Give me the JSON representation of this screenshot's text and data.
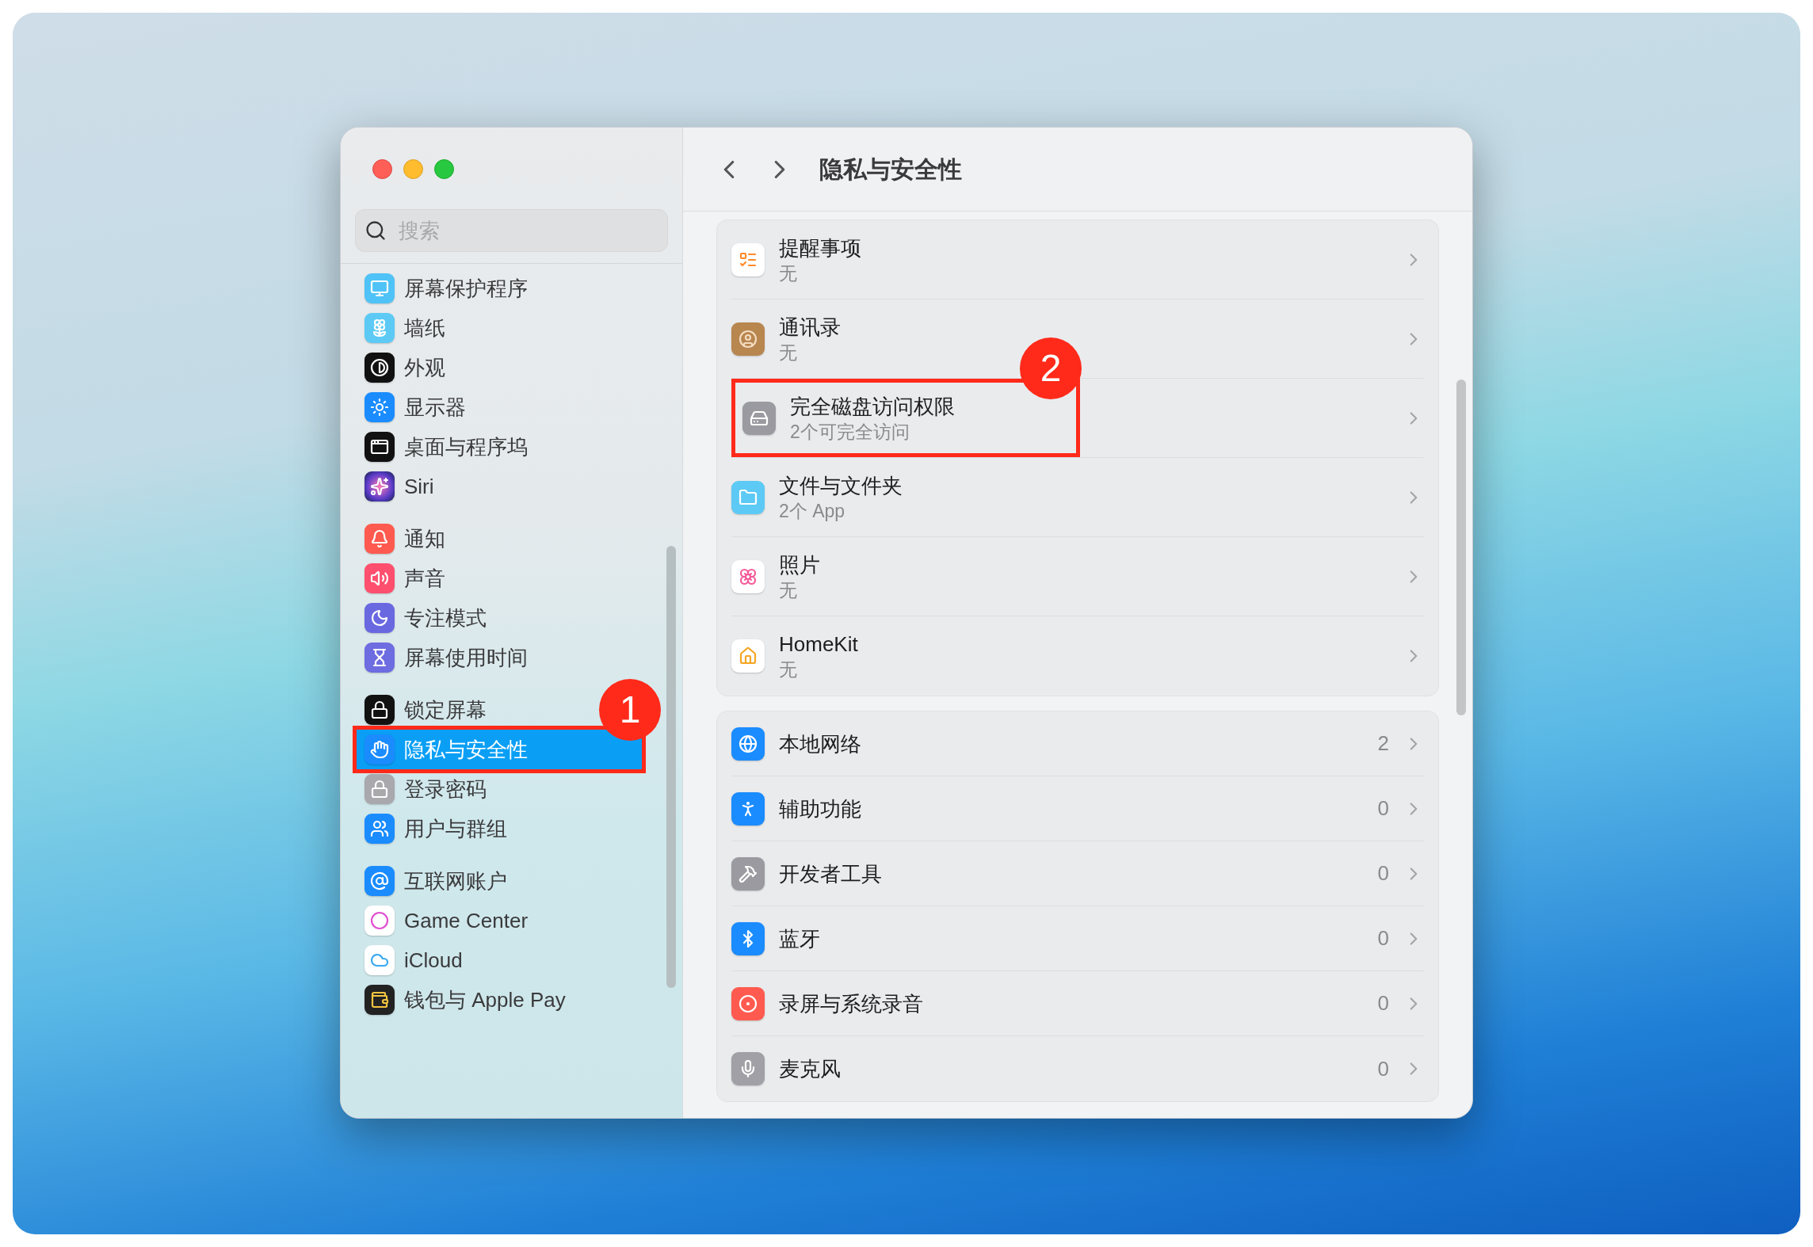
{
  "window": {
    "title": "隐私与安全性"
  },
  "sidebar": {
    "search": {
      "placeholder": "搜索"
    },
    "groups": [
      {
        "items": [
          {
            "label": "屏幕保护程序",
            "selected": false
          },
          {
            "label": "墙纸",
            "selected": false
          },
          {
            "label": "外观",
            "selected": false
          },
          {
            "label": "显示器",
            "selected": false
          },
          {
            "label": "桌面与程序坞",
            "selected": false
          },
          {
            "label": "Siri",
            "selected": false
          }
        ]
      },
      {
        "items": [
          {
            "label": "通知",
            "selected": false
          },
          {
            "label": "声音",
            "selected": false
          },
          {
            "label": "专注模式",
            "selected": false
          },
          {
            "label": "屏幕使用时间",
            "selected": false
          }
        ]
      },
      {
        "items": [
          {
            "label": "锁定屏幕",
            "selected": false
          },
          {
            "label": "隐私与安全性",
            "selected": true,
            "callout": "1"
          },
          {
            "label": "登录密码",
            "selected": false
          },
          {
            "label": "用户与群组",
            "selected": false
          }
        ]
      },
      {
        "items": [
          {
            "label": "互联网账户",
            "selected": false
          },
          {
            "label": "Game Center",
            "selected": false
          },
          {
            "label": "iCloud",
            "selected": false
          },
          {
            "label": "钱包与 Apple Pay",
            "selected": false
          }
        ]
      }
    ]
  },
  "content": {
    "sections": [
      {
        "rows": [
          {
            "title": "提醒事项",
            "subtitle": "无"
          },
          {
            "title": "通讯录",
            "subtitle": "无"
          },
          {
            "title": "完全磁盘访问权限",
            "subtitle": "2个可完全访问",
            "callout": "2"
          },
          {
            "title": "文件与文件夹",
            "subtitle": "2个 App"
          },
          {
            "title": "照片",
            "subtitle": "无"
          },
          {
            "title": "HomeKit",
            "subtitle": "无"
          }
        ]
      },
      {
        "rows": [
          {
            "title": "本地网络",
            "count": "2"
          },
          {
            "title": "辅助功能",
            "count": "0"
          },
          {
            "title": "开发者工具",
            "count": "0"
          },
          {
            "title": "蓝牙",
            "count": "0"
          },
          {
            "title": "录屏与系统录音",
            "count": "0"
          },
          {
            "title": "麦克风",
            "count": "0"
          }
        ]
      }
    ]
  }
}
